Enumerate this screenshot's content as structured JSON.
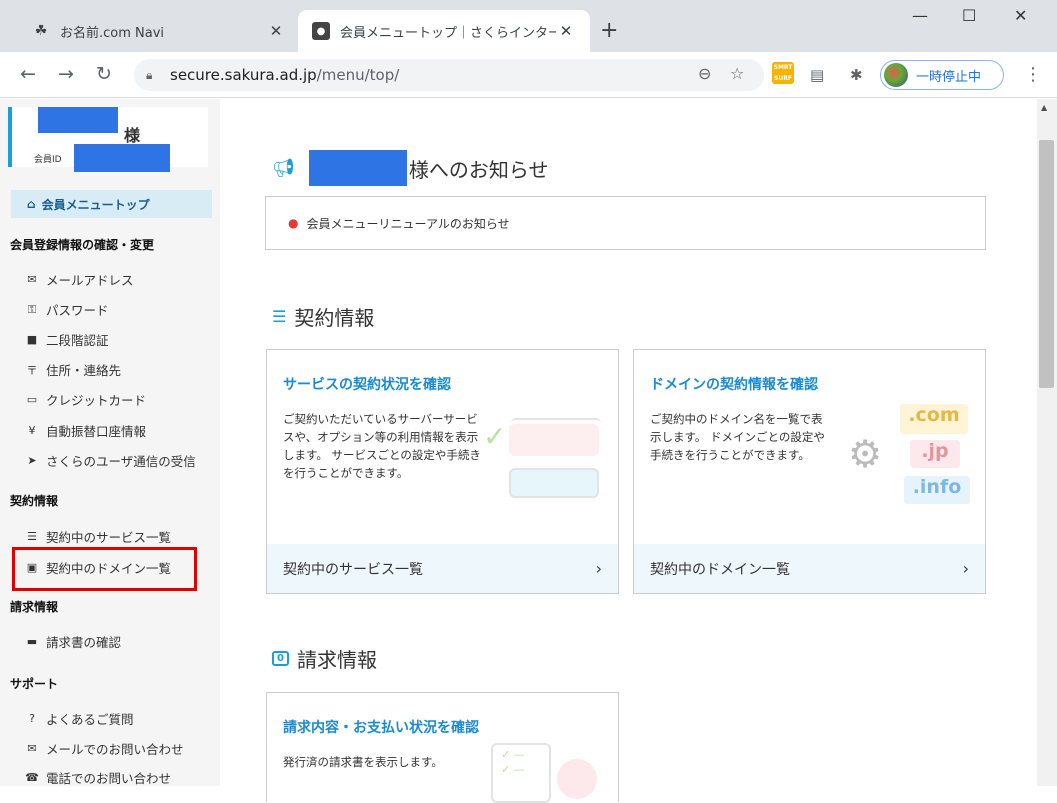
{
  "browser": {
    "tabs": [
      {
        "title": "お名前.com Navi",
        "close": "✕"
      },
      {
        "title": "会員メニュートップ｜さくらインターネット",
        "close": "✕"
      }
    ],
    "new_tab": "+",
    "win_min": "—",
    "win_max": "☐",
    "win_close": "✕",
    "url_host": "secure.sakura.ad.jp",
    "url_path": "/menu/top/",
    "profile_label": "一時停止中",
    "ext_surf_text": "SMRT SURF"
  },
  "sidebar": {
    "user_suffix": "様",
    "member_id_label": "会員ID",
    "top_item": "会員メニュートップ",
    "sections": {
      "account": "会員登録情報の確認・変更",
      "contract": "契約情報",
      "billing": "請求情報",
      "support": "サポート"
    },
    "account_items": [
      "メールアドレス",
      "パスワード",
      "二段階認証",
      "住所・連絡先",
      "クレジットカード",
      "自動振替口座情報",
      "さくらのユーザ通信の受信"
    ],
    "contract_items": [
      "契約中のサービス一覧",
      "契約中のドメイン一覧"
    ],
    "billing_items": [
      "請求書の確認"
    ],
    "support_items": [
      "よくあるご質問",
      "メールでのお問い合わせ",
      "電話でのお問い合わせ"
    ]
  },
  "main": {
    "notice_title_suffix": "様へのお知らせ",
    "notice_text": "会員メニューリニューアルのお知らせ",
    "contract_heading": "契約情報",
    "billing_heading": "請求情報",
    "cards": {
      "service": {
        "title": "サービスの契約状況を確認",
        "desc": "ご契約いただいているサーバーサービスや、オプション等の利用情報を表示します。 サービスごとの設定や手続きを行うことができます。",
        "link": "契約中のサービス一覧"
      },
      "domain": {
        "title": "ドメインの契約情報を確認",
        "desc": "ご契約中のドメイン名を一覧で表示します。 ドメインごとの設定や手続きを行うことができます。",
        "link": "契約中のドメイン一覧",
        "badges": [
          ".com",
          ".jp",
          ".info"
        ]
      },
      "billing": {
        "title": "請求内容・お支払い状況を確認",
        "desc": "発行済の請求書を表示します。"
      }
    }
  },
  "colors": {
    "accent": "#1a8bd0",
    "redact": "#2f74e5",
    "highlight": "#e00000"
  }
}
